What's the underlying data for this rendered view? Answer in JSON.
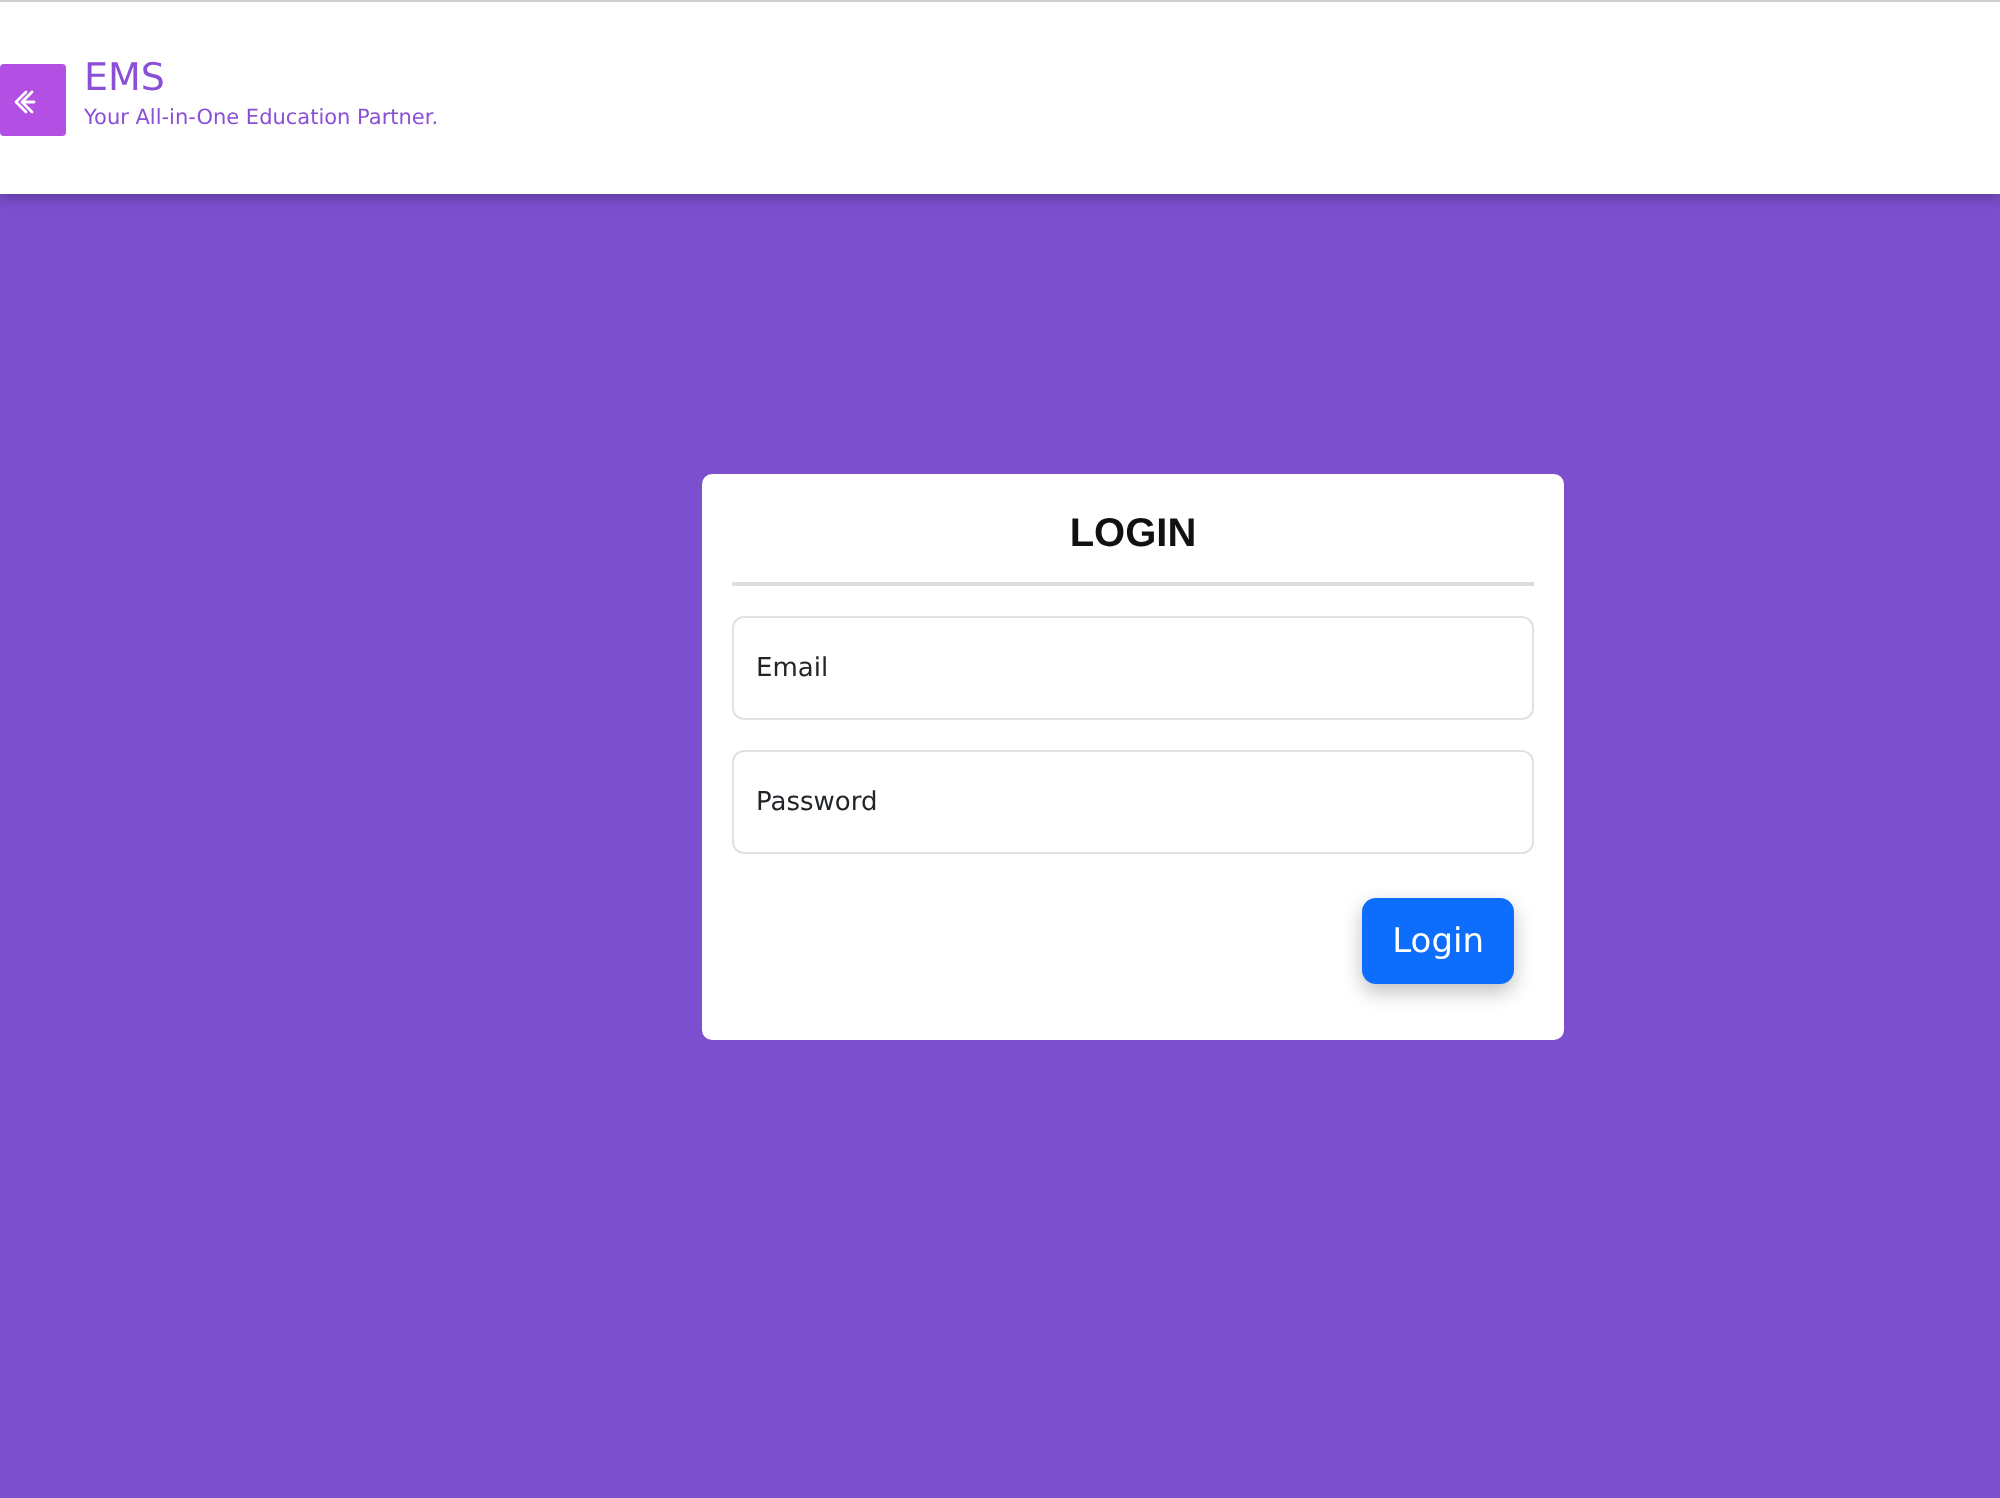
{
  "header": {
    "brand": "EMS",
    "tagline": "Your All-in-One Education Partner."
  },
  "login_card": {
    "title": "LOGIN",
    "email_field": {
      "placeholder": "Email"
    },
    "password_field": {
      "placeholder": "Password"
    },
    "submit_button": "Login"
  }
}
